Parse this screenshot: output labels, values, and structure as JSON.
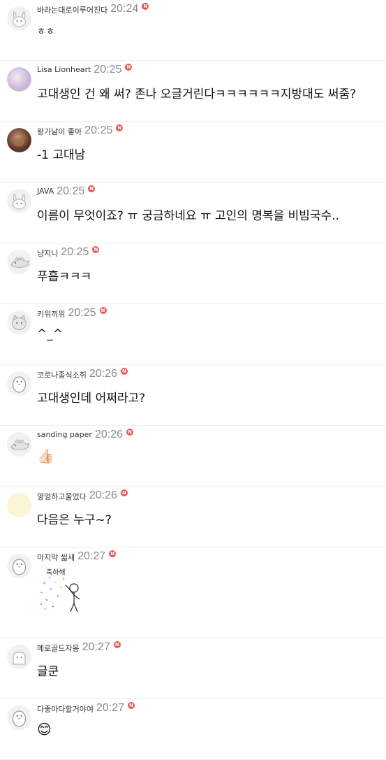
{
  "colors": {
    "badge": "#ef5350",
    "time": "#8a8a8a",
    "divider": "#efefef"
  },
  "badge_glyph": "N",
  "comments": [
    {
      "nickname": "바라는대로이루어진다",
      "time": "20:24",
      "text": "ㅎㅎ",
      "avatar": "rabbit-avatar"
    },
    {
      "nickname": "Lisa Lionheart",
      "time": "20:25",
      "text": "고대생인 건 왜 써? 존나 오글거린다ㅋㅋㅋㅋㅋㅋ지방대도 써줌?",
      "avatar": "lilac-photo-avatar"
    },
    {
      "nickname": "왕가남이 좋아",
      "time": "20:25",
      "text": "-1 고대남",
      "avatar": "brown-photo-avatar"
    },
    {
      "nickname": "JAVA",
      "time": "20:25",
      "text": "이름이 무엇이죠? ㅠ 궁금하네요 ㅠ 고인의 명복을 비빔국수..",
      "avatar": "rabbit-avatar"
    },
    {
      "nickname": "냥지니",
      "time": "20:25",
      "text": "푸흡ㅋㅋㅋ",
      "avatar": "dino-avatar"
    },
    {
      "nickname": "키위끼위",
      "time": "20:25",
      "text": "^_^",
      "avatar": "cat-avatar"
    },
    {
      "nickname": "코로나종식소취",
      "time": "20:26",
      "text": "고대생인데 어쩌라고?",
      "avatar": "penguin-avatar"
    },
    {
      "nickname": "sanding paper",
      "time": "20:26",
      "emoji": "👍🏻",
      "avatar": "dino-avatar"
    },
    {
      "nickname": "영엉하고울었다",
      "time": "20:26",
      "text": "다음은 누구~?",
      "avatar": "cream-avatar"
    },
    {
      "nickname": "마지막 씳새",
      "time": "20:27",
      "sticker": "confetti-sticker",
      "sticker_text": "축하해",
      "avatar": "penguin-avatar"
    },
    {
      "nickname": "메로골드자몽",
      "time": "20:27",
      "text": "글쿤",
      "avatar": "ghost-avatar"
    },
    {
      "nickname": "다좋아다할거야여",
      "time": "20:27",
      "emoji": "😊",
      "avatar": "penguin-avatar"
    }
  ]
}
